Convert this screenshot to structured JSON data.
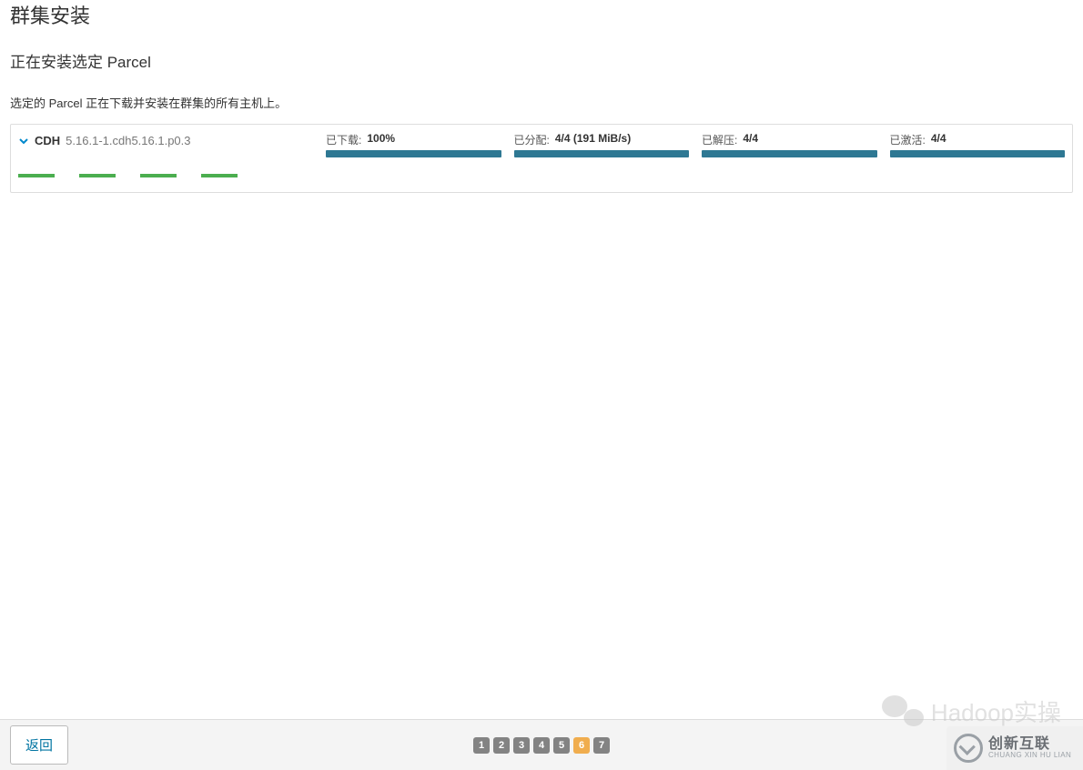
{
  "page": {
    "title": "群集安装",
    "subtitle": "正在安装选定 Parcel",
    "description": "选定的 Parcel 正在下载并安装在群集的所有主机上。"
  },
  "parcel": {
    "name": "CDH",
    "version": "5.16.1-1.cdh5.16.1.p0.3",
    "progress": {
      "downloaded": {
        "label": "已下载:",
        "value": "100%",
        "percent": 100
      },
      "distributed": {
        "label": "已分配:",
        "value": "4/4 (191 MiB/s)",
        "percent": 100
      },
      "unpacked": {
        "label": "已解压:",
        "value": "4/4",
        "percent": 100
      },
      "activated": {
        "label": "已激活:",
        "value": "4/4",
        "percent": 100
      }
    },
    "hosts_count": 4
  },
  "footer": {
    "back_label": "返回",
    "steps": [
      "1",
      "2",
      "3",
      "4",
      "5",
      "6",
      "7"
    ],
    "current_step": "6"
  },
  "watermarks": {
    "wm1_text": "Hadoop实操",
    "wm2_cn": "创新互联",
    "wm2_en": "CHUANG XIN HU LIAN"
  }
}
